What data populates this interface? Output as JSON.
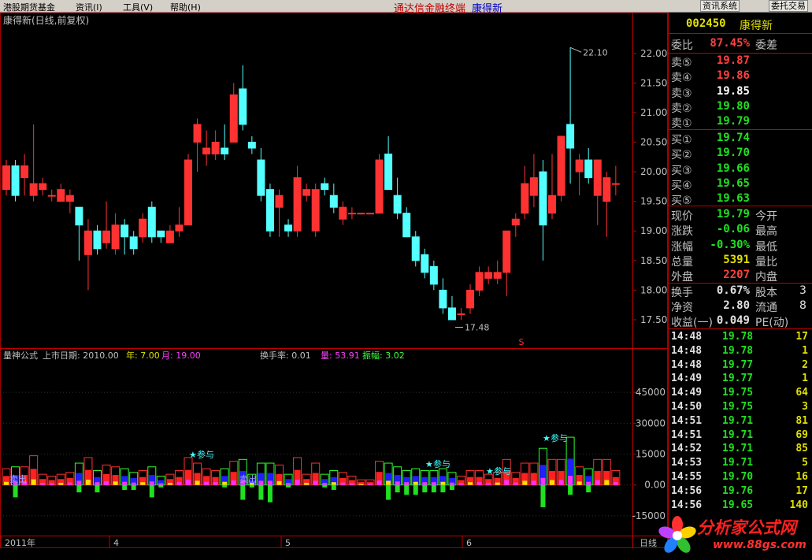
{
  "menubar": {
    "items": [
      "港股期货基金",
      "资讯(I)",
      "工具(V)",
      "帮助(H)"
    ],
    "app_title": "通达信金融终端",
    "stock_name": "康得新",
    "btn_news": "资讯系统",
    "btn_trade": "委托交易"
  },
  "chart": {
    "header": "康得新(日线,前复权)",
    "ind_header": {
      "name": "量神公式",
      "listing_label": "上市日期: 2010.00",
      "year_label": "年: 7.00",
      "month_label": "月: 19.00",
      "turnover_label": "换手率: 0.01",
      "vol_label": "量: 53.91",
      "amp_label": "振幅: 3.02"
    },
    "x_labels": [
      "2011年",
      "4",
      "5",
      "6"
    ],
    "period_label": "日线",
    "hi_label": "22.10",
    "lo_label": "17.48",
    "sell_label": "卖出",
    "join_label": "参与",
    "s_marker": "S"
  },
  "chart_data": [
    {
      "type": "candlestick",
      "title": "康得新(日线,前复权)",
      "y_ticks": [
        "22.00",
        "21.50",
        "21.00",
        "20.50",
        "20.00",
        "19.50",
        "19.00",
        "18.50",
        "18.00",
        "17.50"
      ],
      "ylim": [
        17.3,
        22.25
      ],
      "candles": [
        [
          19.7,
          20.1,
          19.6,
          20.2
        ],
        [
          20.1,
          19.6,
          19.5,
          20.2
        ],
        [
          19.9,
          20.1,
          19.6,
          20.3
        ],
        [
          19.6,
          19.8,
          19.5,
          20.8
        ],
        [
          19.7,
          19.8,
          19.6,
          19.9
        ],
        [
          19.6,
          19.6,
          19.5,
          19.7
        ],
        [
          19.5,
          19.7,
          19.5,
          19.8
        ],
        [
          19.5,
          19.6,
          19.3,
          19.7
        ],
        [
          19.4,
          19.1,
          18.5,
          19.4
        ],
        [
          18.6,
          19.0,
          18.0,
          19.2
        ],
        [
          19.0,
          18.7,
          18.6,
          19.1
        ],
        [
          18.8,
          19.0,
          18.7,
          19.5
        ],
        [
          18.7,
          19.1,
          18.6,
          19.3
        ],
        [
          19.1,
          18.9,
          18.6,
          19.2
        ],
        [
          18.9,
          18.7,
          18.6,
          19.0
        ],
        [
          18.9,
          19.2,
          18.8,
          19.3
        ],
        [
          19.4,
          18.9,
          18.8,
          19.5
        ],
        [
          19.0,
          18.9,
          18.8,
          19.0
        ],
        [
          18.8,
          19.0,
          18.8,
          19.1
        ],
        [
          19.0,
          19.1,
          18.9,
          19.4
        ],
        [
          19.1,
          20.2,
          19.1,
          20.3
        ],
        [
          20.5,
          20.8,
          20.0,
          20.9
        ],
        [
          20.3,
          20.4,
          20.1,
          20.7
        ],
        [
          20.3,
          20.5,
          20.2,
          20.7
        ],
        [
          20.4,
          20.3,
          20.2,
          20.8
        ],
        [
          20.5,
          21.3,
          20.5,
          21.5
        ],
        [
          21.4,
          20.8,
          20.7,
          21.8
        ],
        [
          20.5,
          20.4,
          20.3,
          20.6
        ],
        [
          20.2,
          19.6,
          19.5,
          20.4
        ],
        [
          19.7,
          19.0,
          18.9,
          19.8
        ],
        [
          19.4,
          19.6,
          18.9,
          19.7
        ],
        [
          19.1,
          19.0,
          18.9,
          19.2
        ],
        [
          19.0,
          19.9,
          18.9,
          20.1
        ],
        [
          19.6,
          19.7,
          19.5,
          19.8
        ],
        [
          19.0,
          19.7,
          18.9,
          19.8
        ],
        [
          19.8,
          19.7,
          19.6,
          19.9
        ],
        [
          19.6,
          19.4,
          19.3,
          19.8
        ],
        [
          19.2,
          19.4,
          19.1,
          19.5
        ],
        [
          19.3,
          19.3,
          19.2,
          19.4
        ],
        [
          19.3,
          19.3,
          19.3,
          19.3
        ],
        [
          19.3,
          19.3,
          19.3,
          19.3
        ],
        [
          19.3,
          20.2,
          19.3,
          20.3
        ],
        [
          20.3,
          19.7,
          19.7,
          20.6
        ],
        [
          19.6,
          19.3,
          19.2,
          19.9
        ],
        [
          19.3,
          18.9,
          18.9,
          19.4
        ],
        [
          18.9,
          18.5,
          18.4,
          19.0
        ],
        [
          18.6,
          18.3,
          18.2,
          18.7
        ],
        [
          18.4,
          18.1,
          18.0,
          18.5
        ],
        [
          18.0,
          17.7,
          17.6,
          18.2
        ],
        [
          17.7,
          17.5,
          17.5,
          17.9
        ],
        [
          17.6,
          17.6,
          17.5,
          17.7
        ],
        [
          17.7,
          18.0,
          17.6,
          18.1
        ],
        [
          18.0,
          18.3,
          17.9,
          18.4
        ],
        [
          18.2,
          18.3,
          18.1,
          18.4
        ],
        [
          18.2,
          18.3,
          18.1,
          18.5
        ],
        [
          18.3,
          19.0,
          17.9,
          19.0
        ],
        [
          19.1,
          19.2,
          18.9,
          19.3
        ],
        [
          19.3,
          19.8,
          19.2,
          20.1
        ],
        [
          19.6,
          19.9,
          19.4,
          20.3
        ],
        [
          20.0,
          19.1,
          18.5,
          20.2
        ],
        [
          19.3,
          19.6,
          19.2,
          20.3
        ],
        [
          19.6,
          20.6,
          19.5,
          20.6
        ],
        [
          20.8,
          20.4,
          19.8,
          22.1
        ],
        [
          20.0,
          20.2,
          19.6,
          20.3
        ],
        [
          20.2,
          19.9,
          19.8,
          20.4
        ],
        [
          19.6,
          20.2,
          19.1,
          20.2
        ],
        [
          19.5,
          19.9,
          18.9,
          20.0
        ],
        [
          19.8,
          19.8,
          19.6,
          20.1
        ]
      ]
    },
    {
      "type": "bar",
      "title": "量神公式",
      "y_ticks": [
        "45000",
        "30000",
        "15000",
        "0.00",
        "-15000"
      ],
      "ylim": [
        -20000,
        55000
      ]
    }
  ],
  "panel": {
    "code": "002450",
    "name": "康得新",
    "ratio_label": "委比",
    "ratio_value": "87.45%",
    "ratio_label2": "委差",
    "asks": [
      {
        "label": "卖⑤",
        "price": "19.87",
        "color": "#ff4040"
      },
      {
        "label": "卖④",
        "price": "19.86",
        "color": "#ff4040"
      },
      {
        "label": "卖③",
        "price": "19.85",
        "color": "#ffffff"
      },
      {
        "label": "卖②",
        "price": "19.80",
        "color": "#20e020"
      },
      {
        "label": "卖①",
        "price": "19.79",
        "color": "#20e020"
      }
    ],
    "bids": [
      {
        "label": "买①",
        "price": "19.74",
        "color": "#20e020"
      },
      {
        "label": "买②",
        "price": "19.70",
        "color": "#20e020"
      },
      {
        "label": "买③",
        "price": "19.66",
        "color": "#20e020"
      },
      {
        "label": "买④",
        "price": "19.65",
        "color": "#20e020"
      },
      {
        "label": "买⑤",
        "price": "19.63",
        "color": "#20e020"
      }
    ],
    "quote": [
      {
        "label": "现价",
        "value": "19.79",
        "color": "#20e020",
        "label2": "今开"
      },
      {
        "label": "涨跌",
        "value": "-0.06",
        "color": "#20e020",
        "label2": "最高"
      },
      {
        "label": "涨幅",
        "value": "-0.30%",
        "color": "#20e020",
        "label2": "最低"
      },
      {
        "label": "总量",
        "value": "5391",
        "color": "#e0e000",
        "label2": "量比"
      },
      {
        "label": "外盘",
        "value": "2207",
        "color": "#ff4040",
        "label2": "内盘"
      }
    ],
    "finance": [
      {
        "label": "换手",
        "value": "0.67%",
        "color": "#e0e0e0",
        "label2": "股本"
      },
      {
        "label": "净资",
        "value": "2.80",
        "color": "#e0e0e0",
        "label2": "流通"
      },
      {
        "label": "收益(一)",
        "value": "0.049",
        "color": "#e0e0e0",
        "label2": "PE(动)"
      }
    ],
    "finance_edge": [
      "3",
      "8"
    ],
    "ticks": [
      {
        "time": "14:48",
        "price": "19.78",
        "vol": "17"
      },
      {
        "time": "14:48",
        "price": "19.78",
        "vol": "1"
      },
      {
        "time": "14:48",
        "price": "19.77",
        "vol": "2"
      },
      {
        "time": "14:49",
        "price": "19.77",
        "vol": "1"
      },
      {
        "time": "14:49",
        "price": "19.75",
        "vol": "64"
      },
      {
        "time": "14:50",
        "price": "19.75",
        "vol": "3"
      },
      {
        "time": "14:51",
        "price": "19.71",
        "vol": "81"
      },
      {
        "time": "14:51",
        "price": "19.71",
        "vol": "69"
      },
      {
        "time": "14:52",
        "price": "19.71",
        "vol": "85"
      },
      {
        "time": "14:53",
        "price": "19.71",
        "vol": "5"
      },
      {
        "time": "14:55",
        "price": "19.70",
        "vol": "16"
      },
      {
        "time": "14:56",
        "price": "19.76",
        "vol": "17"
      },
      {
        "time": "14:56",
        "price": "19.65",
        "vol": "140"
      }
    ]
  },
  "watermark": {
    "title": "分析家公式网",
    "url": "www.88gs.com"
  }
}
